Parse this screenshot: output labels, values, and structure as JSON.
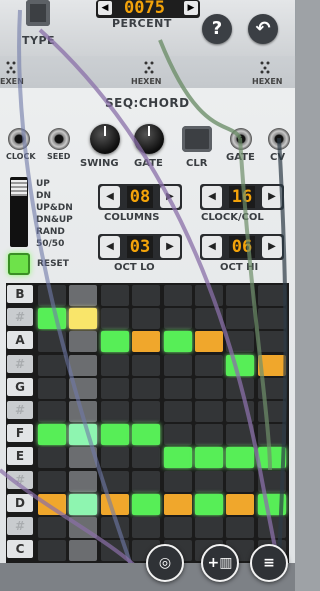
{
  "top": {
    "type_label": "TYPE",
    "percent_label": "PERCENT",
    "percent_value": "0075",
    "help_glyph": "?",
    "back_glyph": "↶",
    "xen_labels": [
      "EXEN",
      "HEXEN",
      "HEXEN"
    ]
  },
  "module": {
    "title": "SEQ:CHORD",
    "labels": {
      "clock": "CLOCK",
      "seed": "SEED",
      "swing": "SWING",
      "gate_knob": "GATE",
      "clr": "CLR",
      "gate_out": "GATE",
      "cv_out": "CV",
      "columns": "COLUMNS",
      "clock_col": "CLOCK/COL",
      "oct_lo": "OCT LO",
      "oct_hi": "OCT HI",
      "reset": "RESET"
    },
    "modes": [
      "UP",
      "DN",
      "UP&DN",
      "DN&UP",
      "RAND",
      "50/50"
    ],
    "slider_level": 0.05,
    "steppers": {
      "columns": "08",
      "clock_col": "16",
      "oct_lo": "03",
      "oct_hi": "06"
    }
  },
  "grid": {
    "notes": [
      "B",
      "#",
      "A",
      "#",
      "G",
      "#",
      "F",
      "E",
      "#",
      "D",
      "#",
      "C"
    ],
    "sharp_rows": [
      1,
      3,
      5,
      8,
      10
    ],
    "rows": [
      [
        0,
        4,
        0,
        0,
        0,
        0,
        0,
        0
      ],
      [
        1,
        3,
        0,
        0,
        0,
        0,
        0,
        0
      ],
      [
        0,
        4,
        1,
        2,
        1,
        2,
        0,
        0
      ],
      [
        0,
        4,
        0,
        0,
        0,
        0,
        1,
        2
      ],
      [
        0,
        4,
        0,
        0,
        0,
        0,
        0,
        0
      ],
      [
        0,
        4,
        0,
        0,
        0,
        0,
        0,
        0
      ],
      [
        1,
        5,
        1,
        1,
        0,
        0,
        0,
        0
      ],
      [
        0,
        4,
        0,
        0,
        1,
        1,
        1,
        1
      ],
      [
        0,
        4,
        0,
        0,
        0,
        0,
        0,
        0
      ],
      [
        2,
        5,
        2,
        1,
        2,
        1,
        2,
        1
      ],
      [
        0,
        4,
        0,
        0,
        0,
        0,
        0,
        0
      ],
      [
        0,
        4,
        0,
        0,
        0,
        0,
        0,
        0
      ]
    ]
  },
  "bottom": {
    "icons": [
      "module-browser-icon",
      "add-module-icon",
      "menu-icon"
    ]
  },
  "colors": {
    "amber": "#f3a30a",
    "green_step": "#57ee57",
    "orange_step": "#f0a72c"
  }
}
